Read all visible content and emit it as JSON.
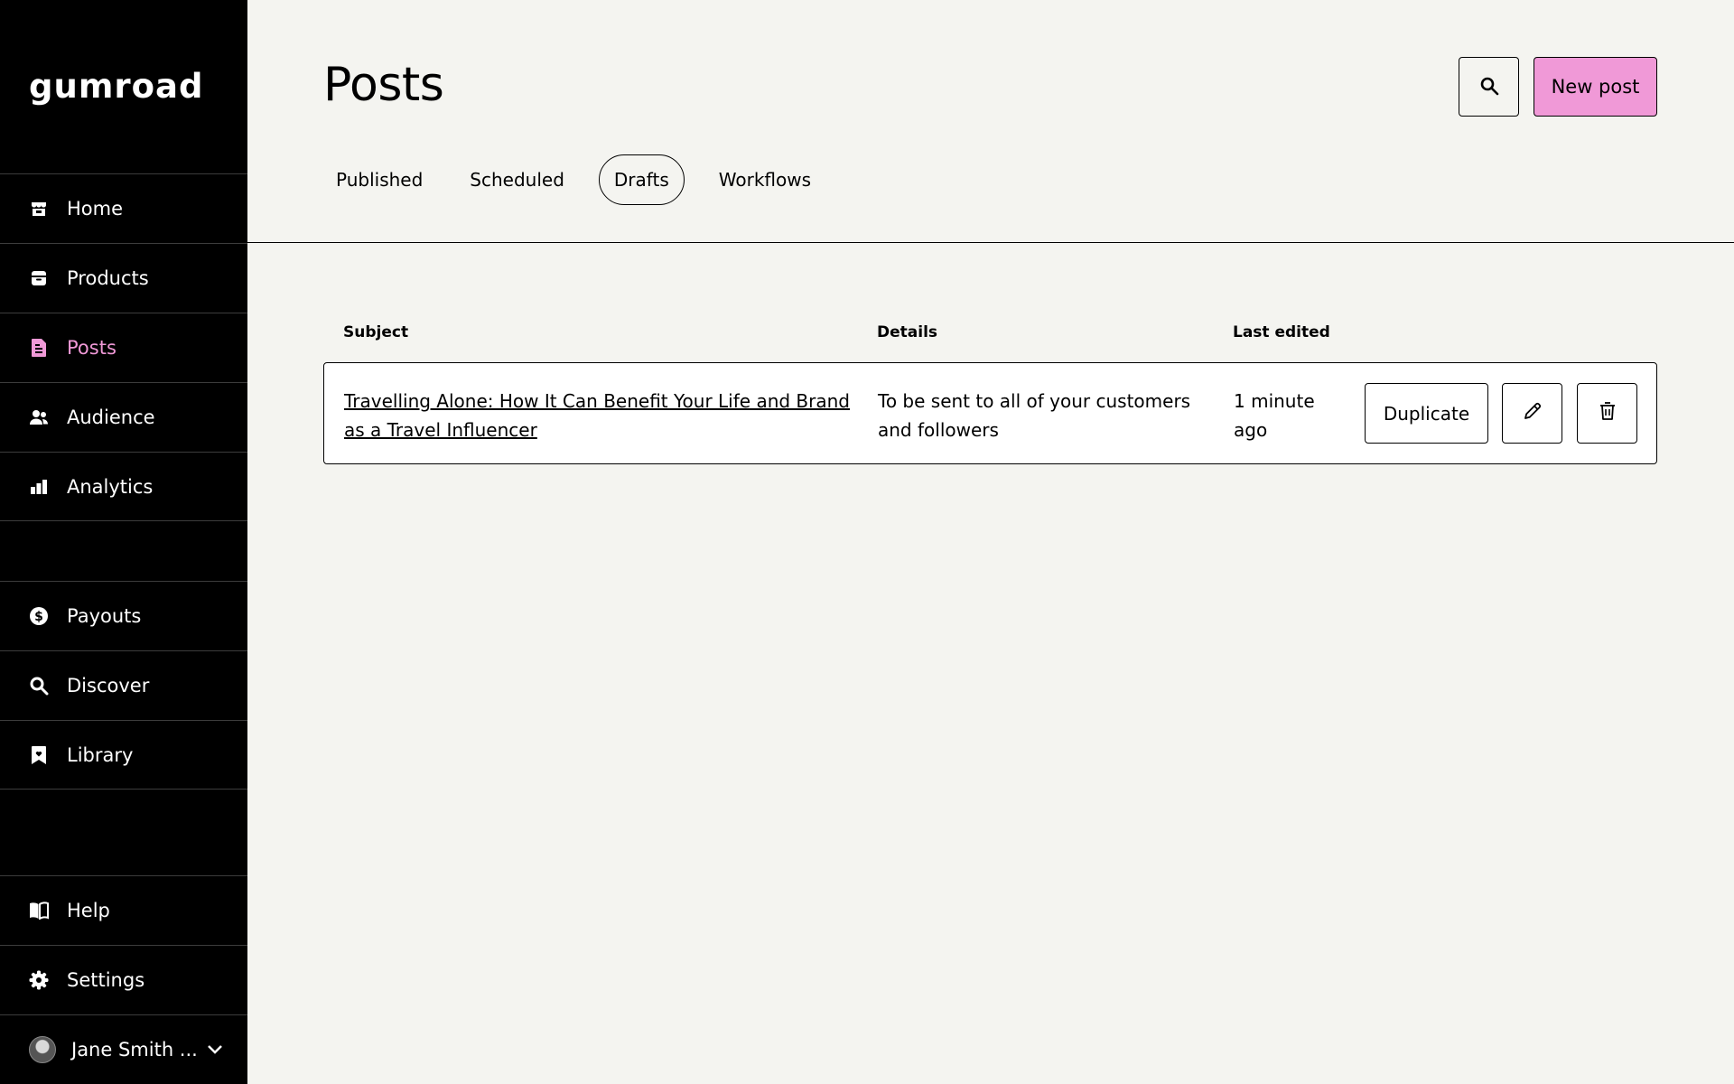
{
  "brand": {
    "logo_text": "gumroad",
    "accent": "#f099d7"
  },
  "sidebar": {
    "items": [
      {
        "label": "Home",
        "icon": "store-icon"
      },
      {
        "label": "Products",
        "icon": "archive-box-icon"
      },
      {
        "label": "Posts",
        "icon": "document-icon",
        "active": true
      },
      {
        "label": "Audience",
        "icon": "people-icon"
      },
      {
        "label": "Analytics",
        "icon": "bar-chart-icon"
      },
      {
        "label": "Payouts",
        "icon": "dollar-circle-icon"
      },
      {
        "label": "Discover",
        "icon": "search-icon"
      },
      {
        "label": "Library",
        "icon": "bookmark-heart-icon"
      },
      {
        "label": "Help",
        "icon": "book-icon"
      },
      {
        "label": "Settings",
        "icon": "gear-icon"
      }
    ],
    "user": {
      "name": "Jane Smith ...",
      "icon": "chevron-down-icon"
    }
  },
  "header": {
    "title": "Posts",
    "search_icon": "search-icon",
    "new_post_label": "New post"
  },
  "tabs": [
    {
      "label": "Published"
    },
    {
      "label": "Scheduled"
    },
    {
      "label": "Drafts",
      "selected": true
    },
    {
      "label": "Workflows"
    }
  ],
  "table": {
    "columns": [
      "Subject",
      "Details",
      "Last edited"
    ],
    "rows": [
      {
        "subject": "Travelling Alone: How It Can Benefit Your Life and Brand as a Travel Influencer",
        "details": "To be sent to all of your customers and followers",
        "last_edited": "1 minute ago",
        "duplicate_label": "Duplicate"
      }
    ]
  }
}
